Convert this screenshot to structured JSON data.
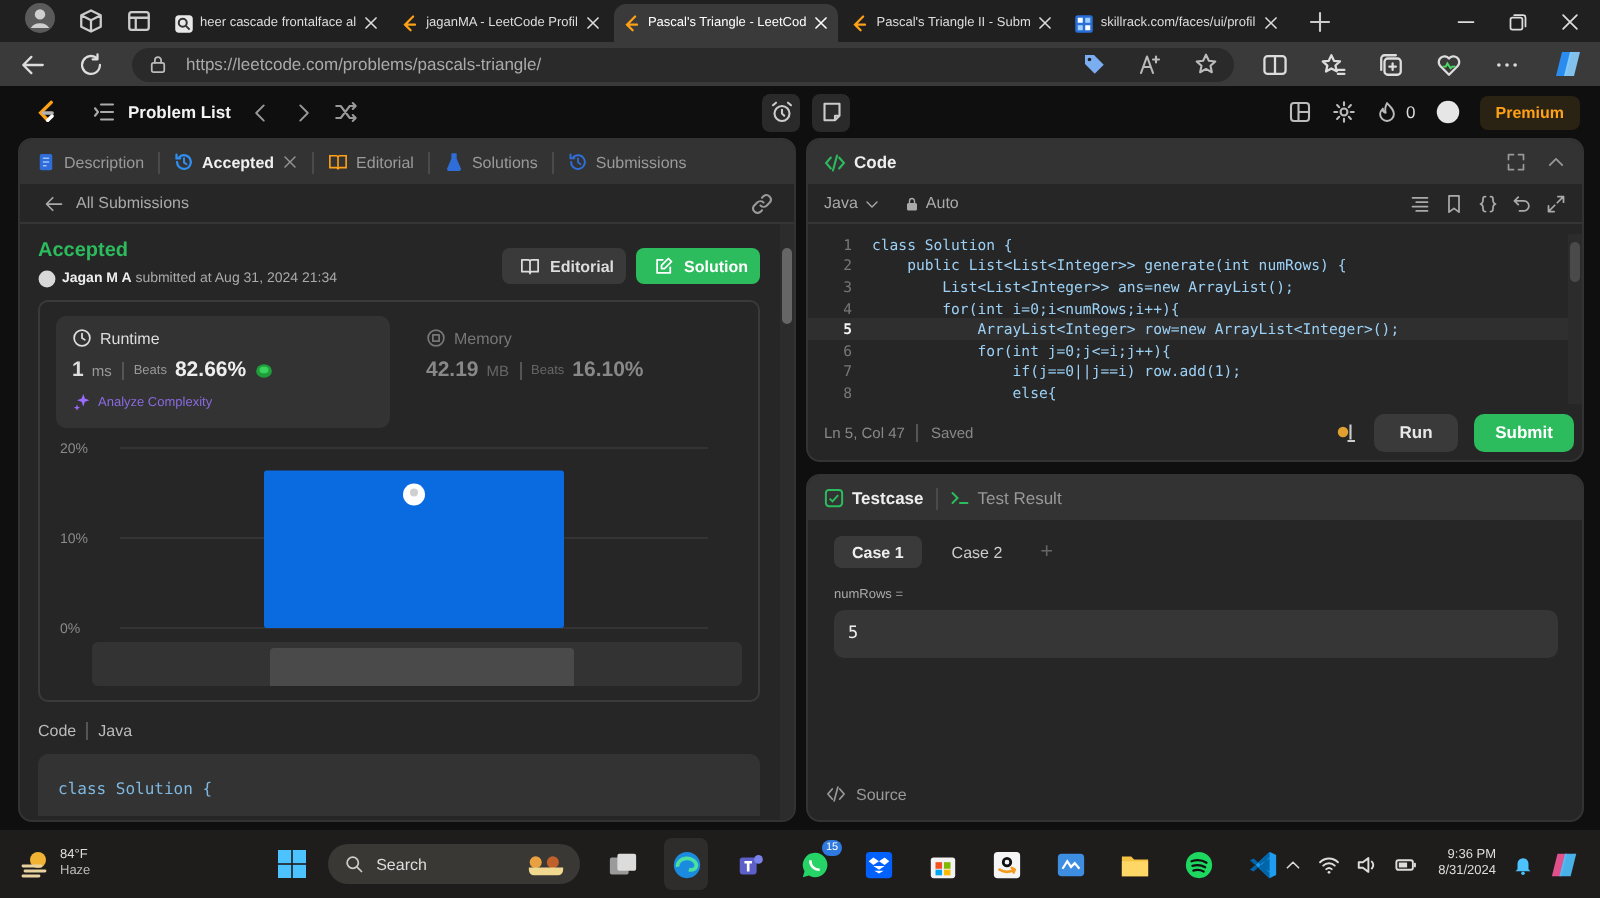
{
  "browser": {
    "tabs": [
      {
        "title": "heer cascade frontalface al",
        "selected": false,
        "kind": "search"
      },
      {
        "title": "jaganMA - LeetCode Profil",
        "selected": false,
        "kind": "leetcode"
      },
      {
        "title": "Pascal's Triangle - LeetCod",
        "selected": true,
        "kind": "leetcode"
      },
      {
        "title": "Pascal's Triangle II - Subm",
        "selected": false,
        "kind": "leetcode"
      },
      {
        "title": "skillrack.com/faces/ui/profil",
        "selected": false,
        "kind": "site"
      }
    ],
    "address": "https://leetcode.com/problems/pascals-triangle/"
  },
  "nav": {
    "title": "Problem List",
    "streak": "0",
    "premium": "Premium"
  },
  "left_panel": {
    "tabs": [
      {
        "label": "Description",
        "selected": false,
        "closable": false
      },
      {
        "label": "Accepted",
        "selected": true,
        "closable": true
      },
      {
        "label": "Editorial",
        "selected": false,
        "closable": false
      },
      {
        "label": "Solutions",
        "selected": false,
        "closable": false
      },
      {
        "label": "Submissions",
        "selected": false,
        "closable": false
      }
    ],
    "back_link": "All Submissions",
    "status": "Accepted",
    "submitter": "**Jagan M A** submitted at Aug 31, 2024 21:34",
    "buttons": [
      {
        "label": "Editorial",
        "kind": "editorial"
      },
      {
        "label": "Solution",
        "kind": "solution"
      }
    ],
    "metrics": [
      {
        "label": "Runtime",
        "value": "1",
        "unit": "ms",
        "beats_label": "Beats",
        "beats": "82.66%",
        "selected": true,
        "kind": "runtime"
      },
      {
        "label": "Memory",
        "value": "42.19",
        "unit": "MB",
        "beats_label": "Beats",
        "beats": "16.10%",
        "selected": false,
        "kind": "memory"
      }
    ],
    "analyze": "Analyze Complexity",
    "chart_data": {
      "type": "bar",
      "values": [
        17.5
      ],
      "ylim": [
        0,
        20
      ],
      "yticks": [
        {
          "value": 0,
          "label": "0%"
        },
        {
          "value": 10,
          "label": "10%"
        },
        {
          "value": 20,
          "label": "20%"
        }
      ]
    },
    "code_label": "Code",
    "code_language": "Java",
    "code_preview": "class Solution {"
  },
  "editor": {
    "title": "Code",
    "language": "Java",
    "mode": "Auto",
    "lines": [
      {
        "number": "1",
        "text": "class Solution {",
        "active": false
      },
      {
        "number": "2",
        "text": "    public List<List<Integer>> generate(int numRows) {",
        "active": false
      },
      {
        "number": "3",
        "text": "        List<List<Integer>> ans=new ArrayList();",
        "active": false
      },
      {
        "number": "4",
        "text": "        for(int i=0;i<numRows;i++){",
        "active": false
      },
      {
        "number": "5",
        "text": "            ArrayList<Integer> row=new ArrayList<Integer>();",
        "active": true
      },
      {
        "number": "6",
        "text": "            for(int j=0;j<=i;j++){",
        "active": false
      },
      {
        "number": "7",
        "text": "                if(j==0||j==i) row.add(1);",
        "active": false
      },
      {
        "number": "8",
        "text": "                else{",
        "active": false
      }
    ],
    "cursor": "Ln 5, Col 47",
    "save_state": "Saved",
    "buttons": [
      {
        "label": "Run",
        "kind": "run"
      },
      {
        "label": "Submit",
        "kind": "submit"
      }
    ]
  },
  "testcase": {
    "tabs": [
      {
        "label": "Testcase",
        "selected": true
      },
      {
        "label": "Test Result",
        "selected": false
      }
    ],
    "cases": [
      {
        "label": "Case 1",
        "selected": true
      },
      {
        "label": "Case 2",
        "selected": false
      }
    ],
    "add": "+",
    "param": "numRows =",
    "value": "5",
    "source": "Source"
  },
  "taskbar": {
    "temperature": "84°F",
    "weather": "Haze",
    "search": "Search",
    "badge": "15",
    "time": "9:36 PM",
    "date": "8/31/2024"
  }
}
